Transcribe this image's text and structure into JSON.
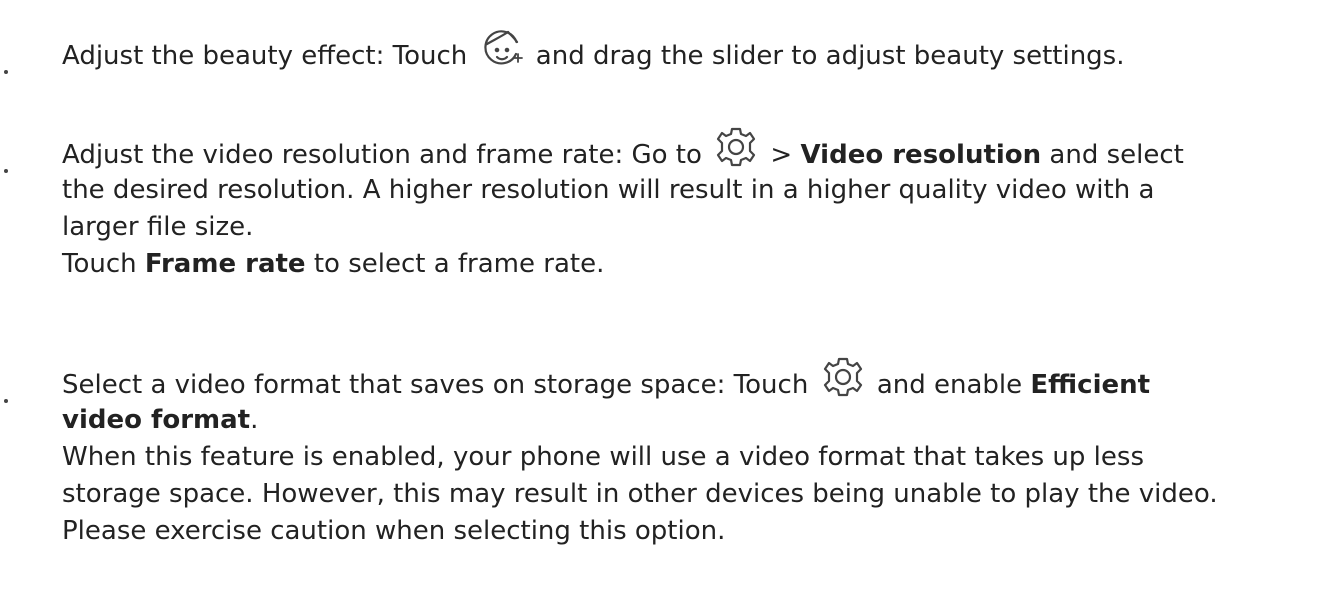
{
  "items": [
    {
      "pre": "Adjust the beauty effect: Touch ",
      "icon": "beauty-face-icon",
      "post": " and drag the slider to adjust beauty settings."
    },
    {
      "pre": "Adjust the video resolution and frame rate: Go to ",
      "icon": "settings-gear-icon",
      "mid": " > ",
      "bold1": "Video resolution",
      "post1": " and select",
      "line2": "the desired resolution. A higher resolution will result in a higher quality video with a",
      "line3": "larger file size.",
      "line4_pre": "Touch ",
      "line4_bold": "Frame rate",
      "line4_post": " to select a frame rate."
    },
    {
      "pre": "Select a video format that saves on storage space: Touch ",
      "icon": "settings-gear-icon",
      "post1": " and enable ",
      "bold1": "Efficient",
      "line2_bold": "video format",
      "line2_post": ".",
      "line3": "When this feature is enabled, your phone will use a video format that takes up less",
      "line4": "storage space. However, this may result in other devices being unable to play the video.",
      "line5": "Please exercise caution when selecting this option."
    }
  ]
}
